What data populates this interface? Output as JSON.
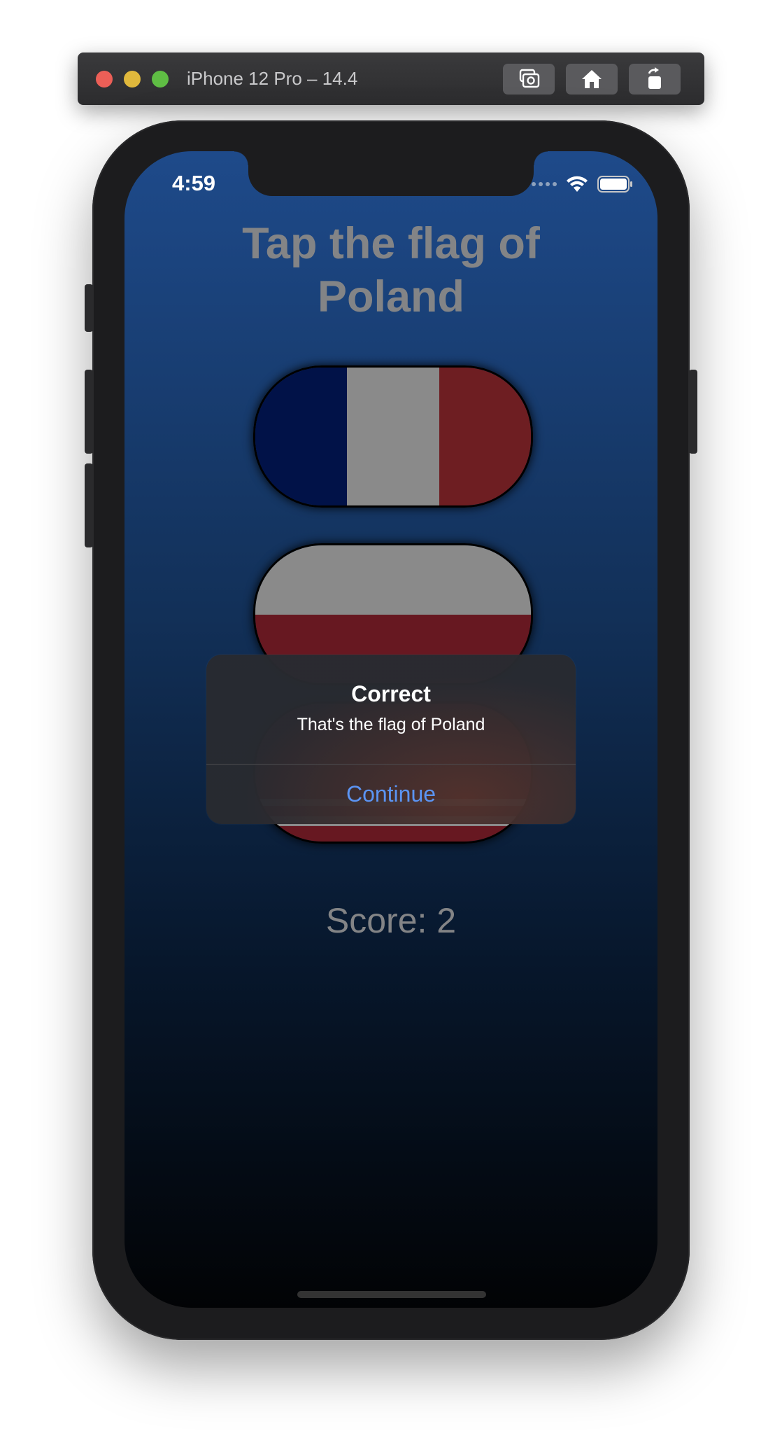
{
  "simulator": {
    "title": "iPhone 12 Pro – 14.4",
    "buttons": [
      "screenshot-icon",
      "home-icon",
      "rotate-icon"
    ]
  },
  "status_bar": {
    "time": "4:59"
  },
  "game": {
    "prompt_line1": "Tap the flag of",
    "prompt_line2": "Poland",
    "flags": [
      {
        "name": "France",
        "colors": [
          "#011248",
          "#8a8a8a",
          "#6e1e22"
        ]
      },
      {
        "name": "Poland",
        "colors": [
          "#8a8a8a",
          "#671821"
        ]
      },
      {
        "name": "Striped",
        "colors": [
          "#8a8a8a",
          "#671821"
        ]
      }
    ],
    "score": "Score: 2"
  },
  "alert": {
    "title": "Correct",
    "message": "That's the flag of Poland",
    "button": "Continue"
  },
  "colors": {
    "accent": "#5b94f3",
    "text_gray": "#838486"
  }
}
